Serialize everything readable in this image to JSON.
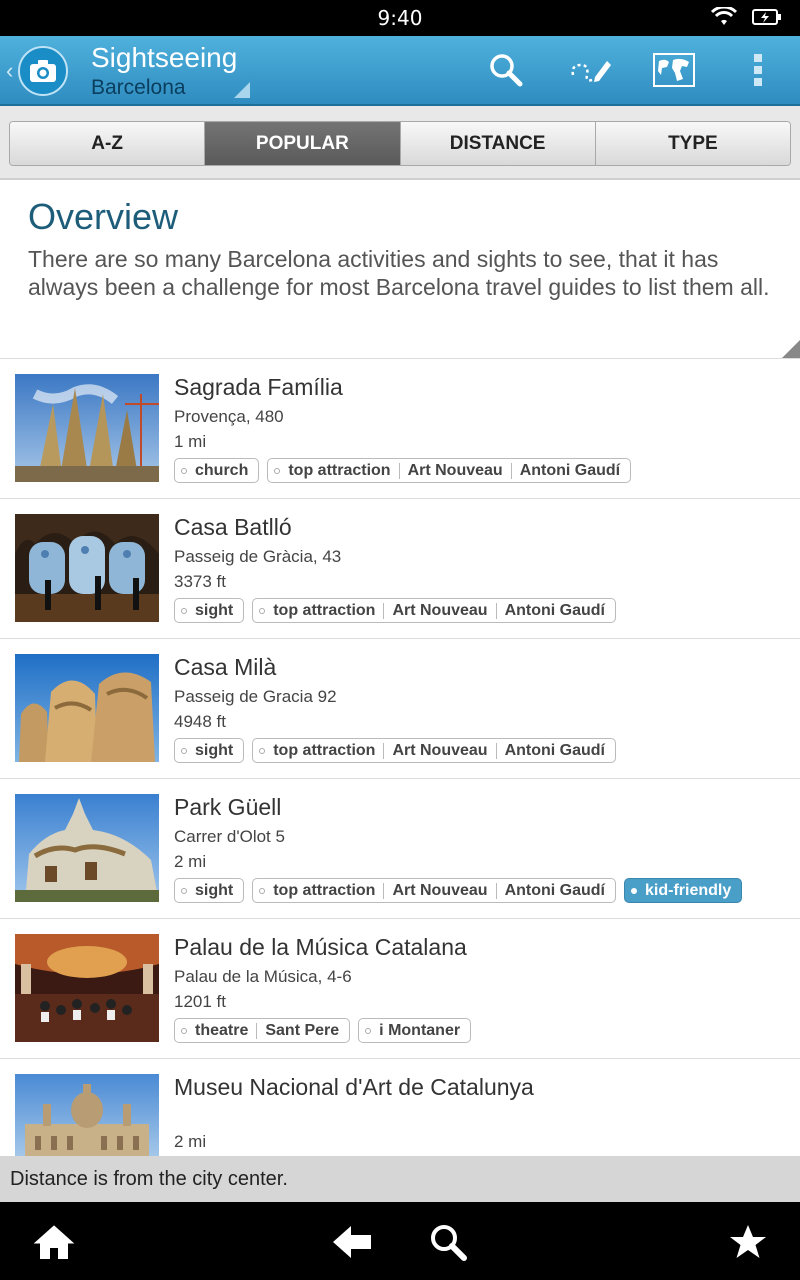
{
  "status": {
    "time": "9:40"
  },
  "header": {
    "title": "Sightseeing",
    "subtitle": "Barcelona"
  },
  "tabs": [
    {
      "label": "A-Z"
    },
    {
      "label": "POPULAR"
    },
    {
      "label": "DISTANCE"
    },
    {
      "label": "TYPE"
    }
  ],
  "overview": {
    "title": "Overview",
    "text": "There are so many Barcelona activities and sights to see, that it has always been a challenge for most Barcelona travel guides to list them all."
  },
  "items": [
    {
      "name": "Sagrada Família",
      "address": "Provença, 480",
      "distance": "1 mi",
      "tags": [
        [
          "church"
        ],
        [
          "top attraction",
          "Art Nouveau",
          "Antoni Gaudí"
        ]
      ]
    },
    {
      "name": "Casa Batlló",
      "address": "Passeig de Gràcia, 43",
      "distance": "3373 ft",
      "tags": [
        [
          "sight"
        ],
        [
          "top attraction",
          "Art Nouveau",
          "Antoni Gaudí"
        ]
      ]
    },
    {
      "name": "Casa Milà",
      "address": "Passeig de Gracia 92",
      "distance": "4948 ft",
      "tags": [
        [
          "sight"
        ],
        [
          "top attraction",
          "Art Nouveau",
          "Antoni Gaudí"
        ]
      ]
    },
    {
      "name": "Park Güell",
      "address": "Carrer d'Olot 5",
      "distance": "2 mi",
      "tags": [
        [
          "sight"
        ],
        [
          "top attraction",
          "Art Nouveau",
          "Antoni Gaudí"
        ]
      ],
      "highlight_tag": "kid-friendly"
    },
    {
      "name": "Palau de la Música Catalana",
      "address": "Palau de la Música, 4-6",
      "distance": "1201 ft",
      "tags": [
        [
          "theatre",
          "Sant Pere"
        ],
        [
          "i Montaner"
        ]
      ]
    },
    {
      "name": "Museu Nacional d'Art de Catalunya",
      "address": "",
      "distance": "2 mi",
      "tags": []
    }
  ],
  "footer_note": "Distance is from the city center.",
  "colors": {
    "action_bar": "#3a9bcf",
    "highlight_tag": "#4a9fc9",
    "tab_active": "#666666"
  },
  "icons": {
    "header": [
      "back-chevron-icon",
      "camera-logo-icon",
      "search-icon",
      "route-edit-icon",
      "world-map-icon",
      "overflow-menu-icon"
    ],
    "bottom_nav": [
      "home-icon",
      "back-arrow-icon",
      "search-icon",
      "star-icon"
    ]
  }
}
